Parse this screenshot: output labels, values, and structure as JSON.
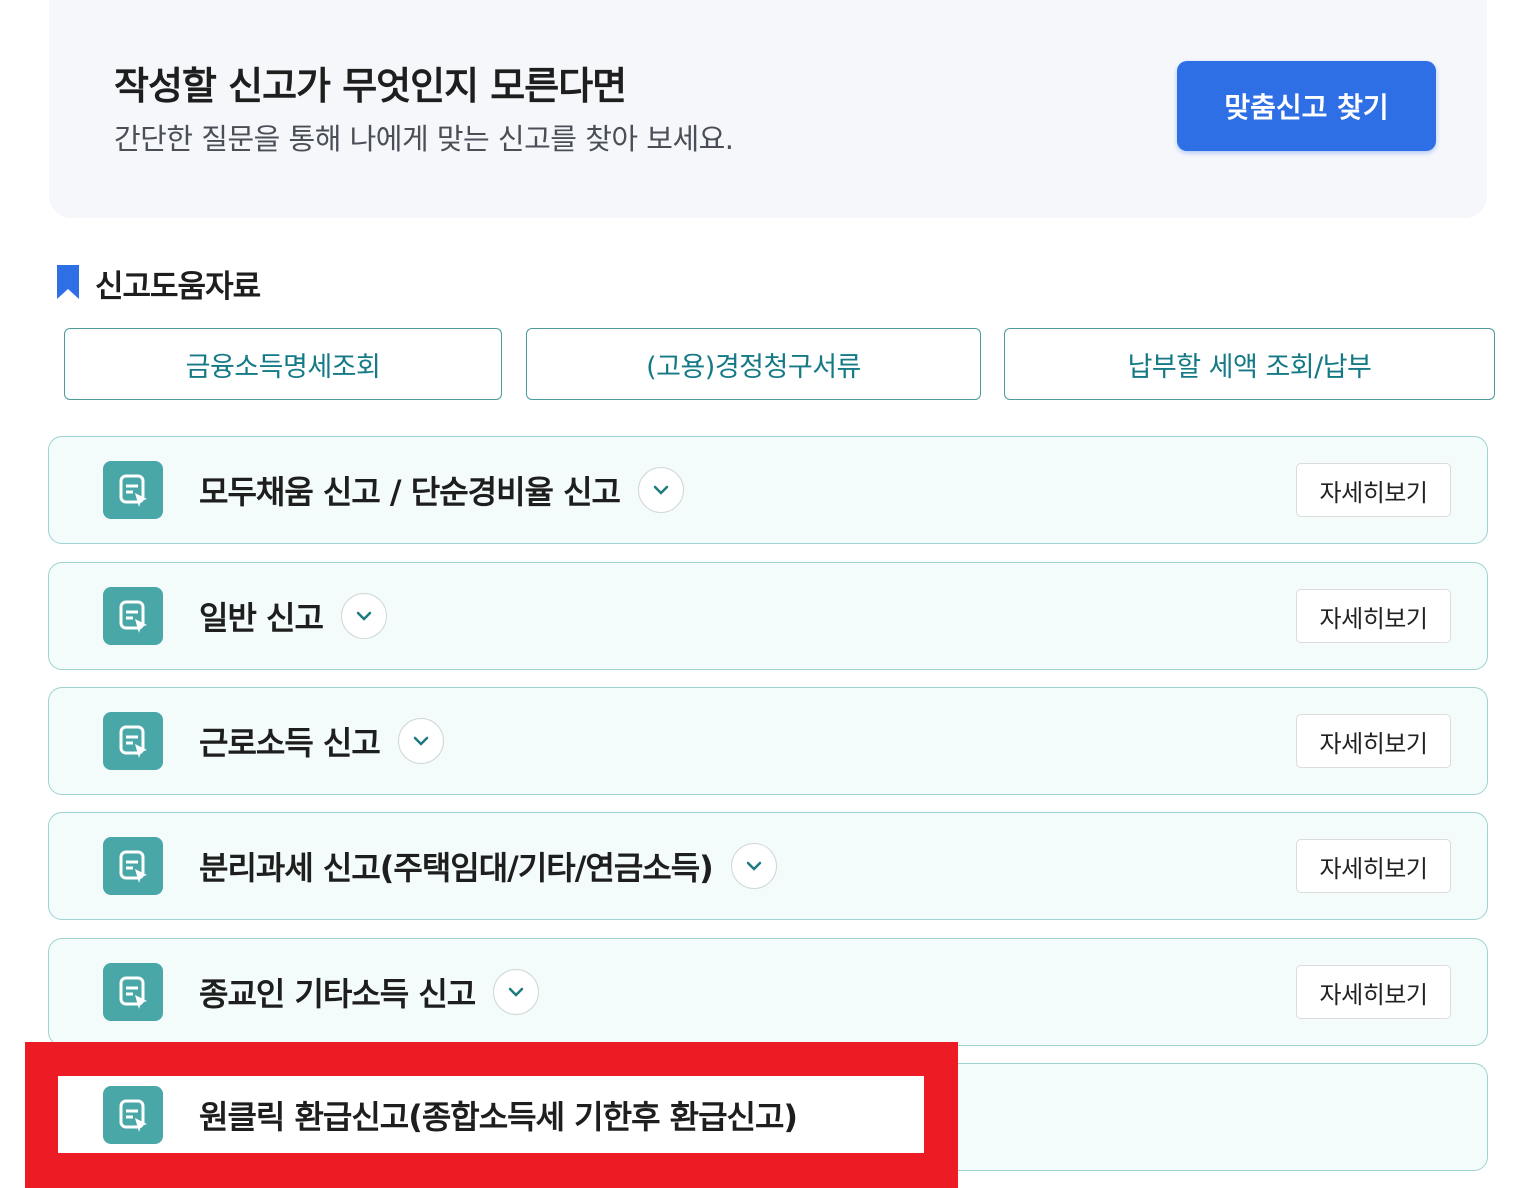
{
  "banner": {
    "title": "작성할 신고가 무엇인지 모른다면",
    "subtitle": "간단한 질문을 통해 나에게 맞는 신고를 찾아 보세요.",
    "button_label": "맞춤신고 찾기"
  },
  "resources": {
    "title": "신고도움자료",
    "buttons": [
      "금융소득명세조회",
      "(고용)경정청구서류",
      "납부할 세액 조회/납부"
    ]
  },
  "filing_items": [
    {
      "title": "모두채움 신고 / 단순경비율 신고",
      "detail_label": "자세히보기"
    },
    {
      "title": "일반 신고",
      "detail_label": "자세히보기"
    },
    {
      "title": "근로소득 신고",
      "detail_label": "자세히보기"
    },
    {
      "title": "분리과세 신고(주택임대/기타/연금소득)",
      "detail_label": "자세히보기"
    },
    {
      "title": "종교인 기타소득 신고",
      "detail_label": "자세히보기"
    },
    {
      "title": "원클릭 환급신고(종합소득세 기한후 환급신고)"
    }
  ],
  "colors": {
    "primary_blue": "#2f6fe6",
    "teal": "#4aa7a7",
    "highlight_red": "#ed1c24"
  },
  "icons": {
    "card_icon": "document-edit-icon",
    "expand_icon": "chevron-down-icon",
    "section_icon": "bookmark-icon"
  }
}
